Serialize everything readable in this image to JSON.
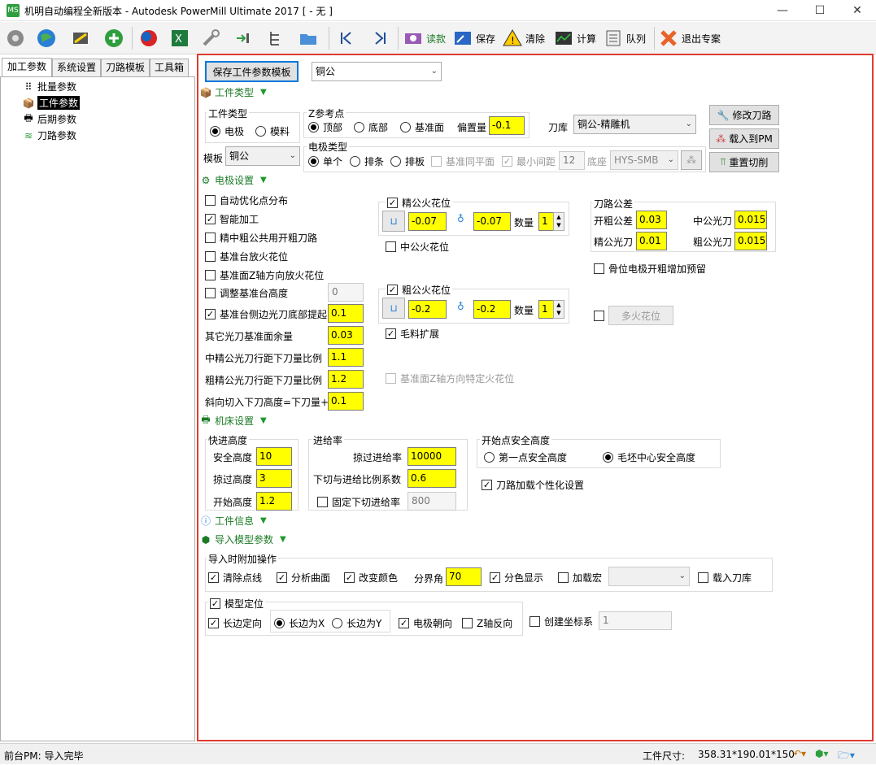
{
  "window": {
    "title": "机明自动编程全新版本 - Autodesk PowerMill Ultimate 2017   [ - 无 ]",
    "minimize": "—",
    "maximize": "☐",
    "close": "✕"
  },
  "toolbar": {
    "read": "读款",
    "save": "保存",
    "clear": "清除",
    "compute": "计算",
    "queue": "队列",
    "exit": "退出专案"
  },
  "left_tabs": [
    "加工参数",
    "系统设置",
    "刀路模板",
    "工具箱"
  ],
  "tree": [
    "批量参数",
    "工件参数",
    "后期参数",
    "刀路参数"
  ],
  "top": {
    "save_template": "保存工件参数模板",
    "template_combo": "铜公"
  },
  "sections": {
    "workpiece_type": "工件类型",
    "electrode": "电极设置",
    "machine": "机床设置",
    "workpiece_info": "工件信息",
    "import_model": "导入模型参数"
  },
  "workpiece": {
    "type_group": "工件类型",
    "type_electrode": "电极",
    "type_blank": "模料",
    "template_label": "模板",
    "template_value": "铜公",
    "z_group": "Z参考点",
    "z_top": "顶部",
    "z_bottom": "底部",
    "z_base": "基准面",
    "offset_label": "偏置量",
    "offset_value": "-0.1",
    "library_label": "刀库",
    "library_value": "铜公-精雕机",
    "etype_group": "电极类型",
    "etype_single": "单个",
    "etype_row": "排条",
    "etype_plate": "排板",
    "base_plane": "基准同平面",
    "min_gap": "最小间距",
    "min_gap_value": "12",
    "base_label": "底座",
    "base_value": "HYS-SMB",
    "modify_path": "修改刀路",
    "load_pm": "载入到PM",
    "reset_cut": "重置切削"
  },
  "electrode": {
    "auto_opt": "自动优化点分布",
    "smart": "智能加工",
    "share_rough": "精中粗公共用开粗刀路",
    "base_spark": "基准台放火花位",
    "base_z_spark": "基准面Z轴方向放火花位",
    "adjust_base": "调整基准台高度",
    "adjust_base_value": "0",
    "base_side_lift": "基准台侧边光刀底部提起",
    "base_side_lift_value": "0.1",
    "other_allow": "其它光刀基准面余量",
    "other_allow_value": "0.03",
    "mid_ratio": "中精公光刀行距下刀量比例",
    "mid_ratio_value": "1.1",
    "rough_ratio": "粗精公光刀行距下刀量比例",
    "rough_ratio_value": "1.2",
    "ramp": "斜向切入下刀高度=下刀量+",
    "ramp_value": "0.1",
    "fine_spark": "精公火花位",
    "fine_v1": "-0.07",
    "fine_v2": "-0.07",
    "count_label": "数量",
    "fine_count": "1",
    "mid_spark": "中公火花位",
    "rough_spark": "粗公火花位",
    "rough_v1": "-0.2",
    "rough_v2": "-0.2",
    "rough_count": "1",
    "blank_expand": "毛料扩展",
    "base_z_specific": "基准面Z轴方向特定火花位",
    "tol_group": "刀路公差",
    "tol_open_rough": "开粗公差",
    "tol_open_rough_value": "0.03",
    "tol_mid_finish": "中公光刀",
    "tol_mid_finish_value": "0.015",
    "tol_fine_finish": "精公光刀",
    "tol_fine_finish_value": "0.01",
    "tol_rough_finish": "粗公光刀",
    "tol_rough_finish_value": "0.015",
    "bone_reserve": "骨位电极开粗增加预留",
    "multi_spark": "多火花位"
  },
  "machine": {
    "rapid_group": "快进高度",
    "safe": "安全高度",
    "safe_value": "10",
    "skim": "掠过高度",
    "skim_value": "3",
    "start": "开始高度",
    "start_value": "1.2",
    "feed_group": "进给率",
    "skim_feed": "掠过进给率",
    "skim_feed_value": "10000",
    "plunge_ratio": "下切与进给比例系数",
    "plunge_ratio_value": "0.6",
    "fixed_plunge": "固定下切进给率",
    "fixed_plunge_value": "800",
    "startpt_group": "开始点安全高度",
    "first_point": "第一点安全高度",
    "blank_center": "毛坯中心安全高度",
    "personal": "刀路加载个性化设置"
  },
  "import": {
    "extra_group": "导入时附加操作",
    "clear_lines": "清除点线",
    "analyze": "分析曲面",
    "recolor": "改变颜色",
    "angle_label": "分界角",
    "angle_value": "70",
    "color_show": "分色显示",
    "load_macro": "加载宏",
    "load_lib": "载入刀库",
    "orient_group": "模型定位",
    "long_side": "长边定向",
    "long_x": "长边为X",
    "long_y": "长边为Y",
    "electrode_dir": "电极朝向",
    "z_reverse": "Z轴反向",
    "create_cs": "创建坐标系",
    "cs_value": "1"
  },
  "status": {
    "left": "前台PM: 导入完毕",
    "size_label": "工件尺寸:",
    "size_value": "358.31*190.01*150"
  },
  "colors": {
    "highlight_input": "#ffff00",
    "panel_border": "#e03c31",
    "section_text": "#1a7a24"
  }
}
